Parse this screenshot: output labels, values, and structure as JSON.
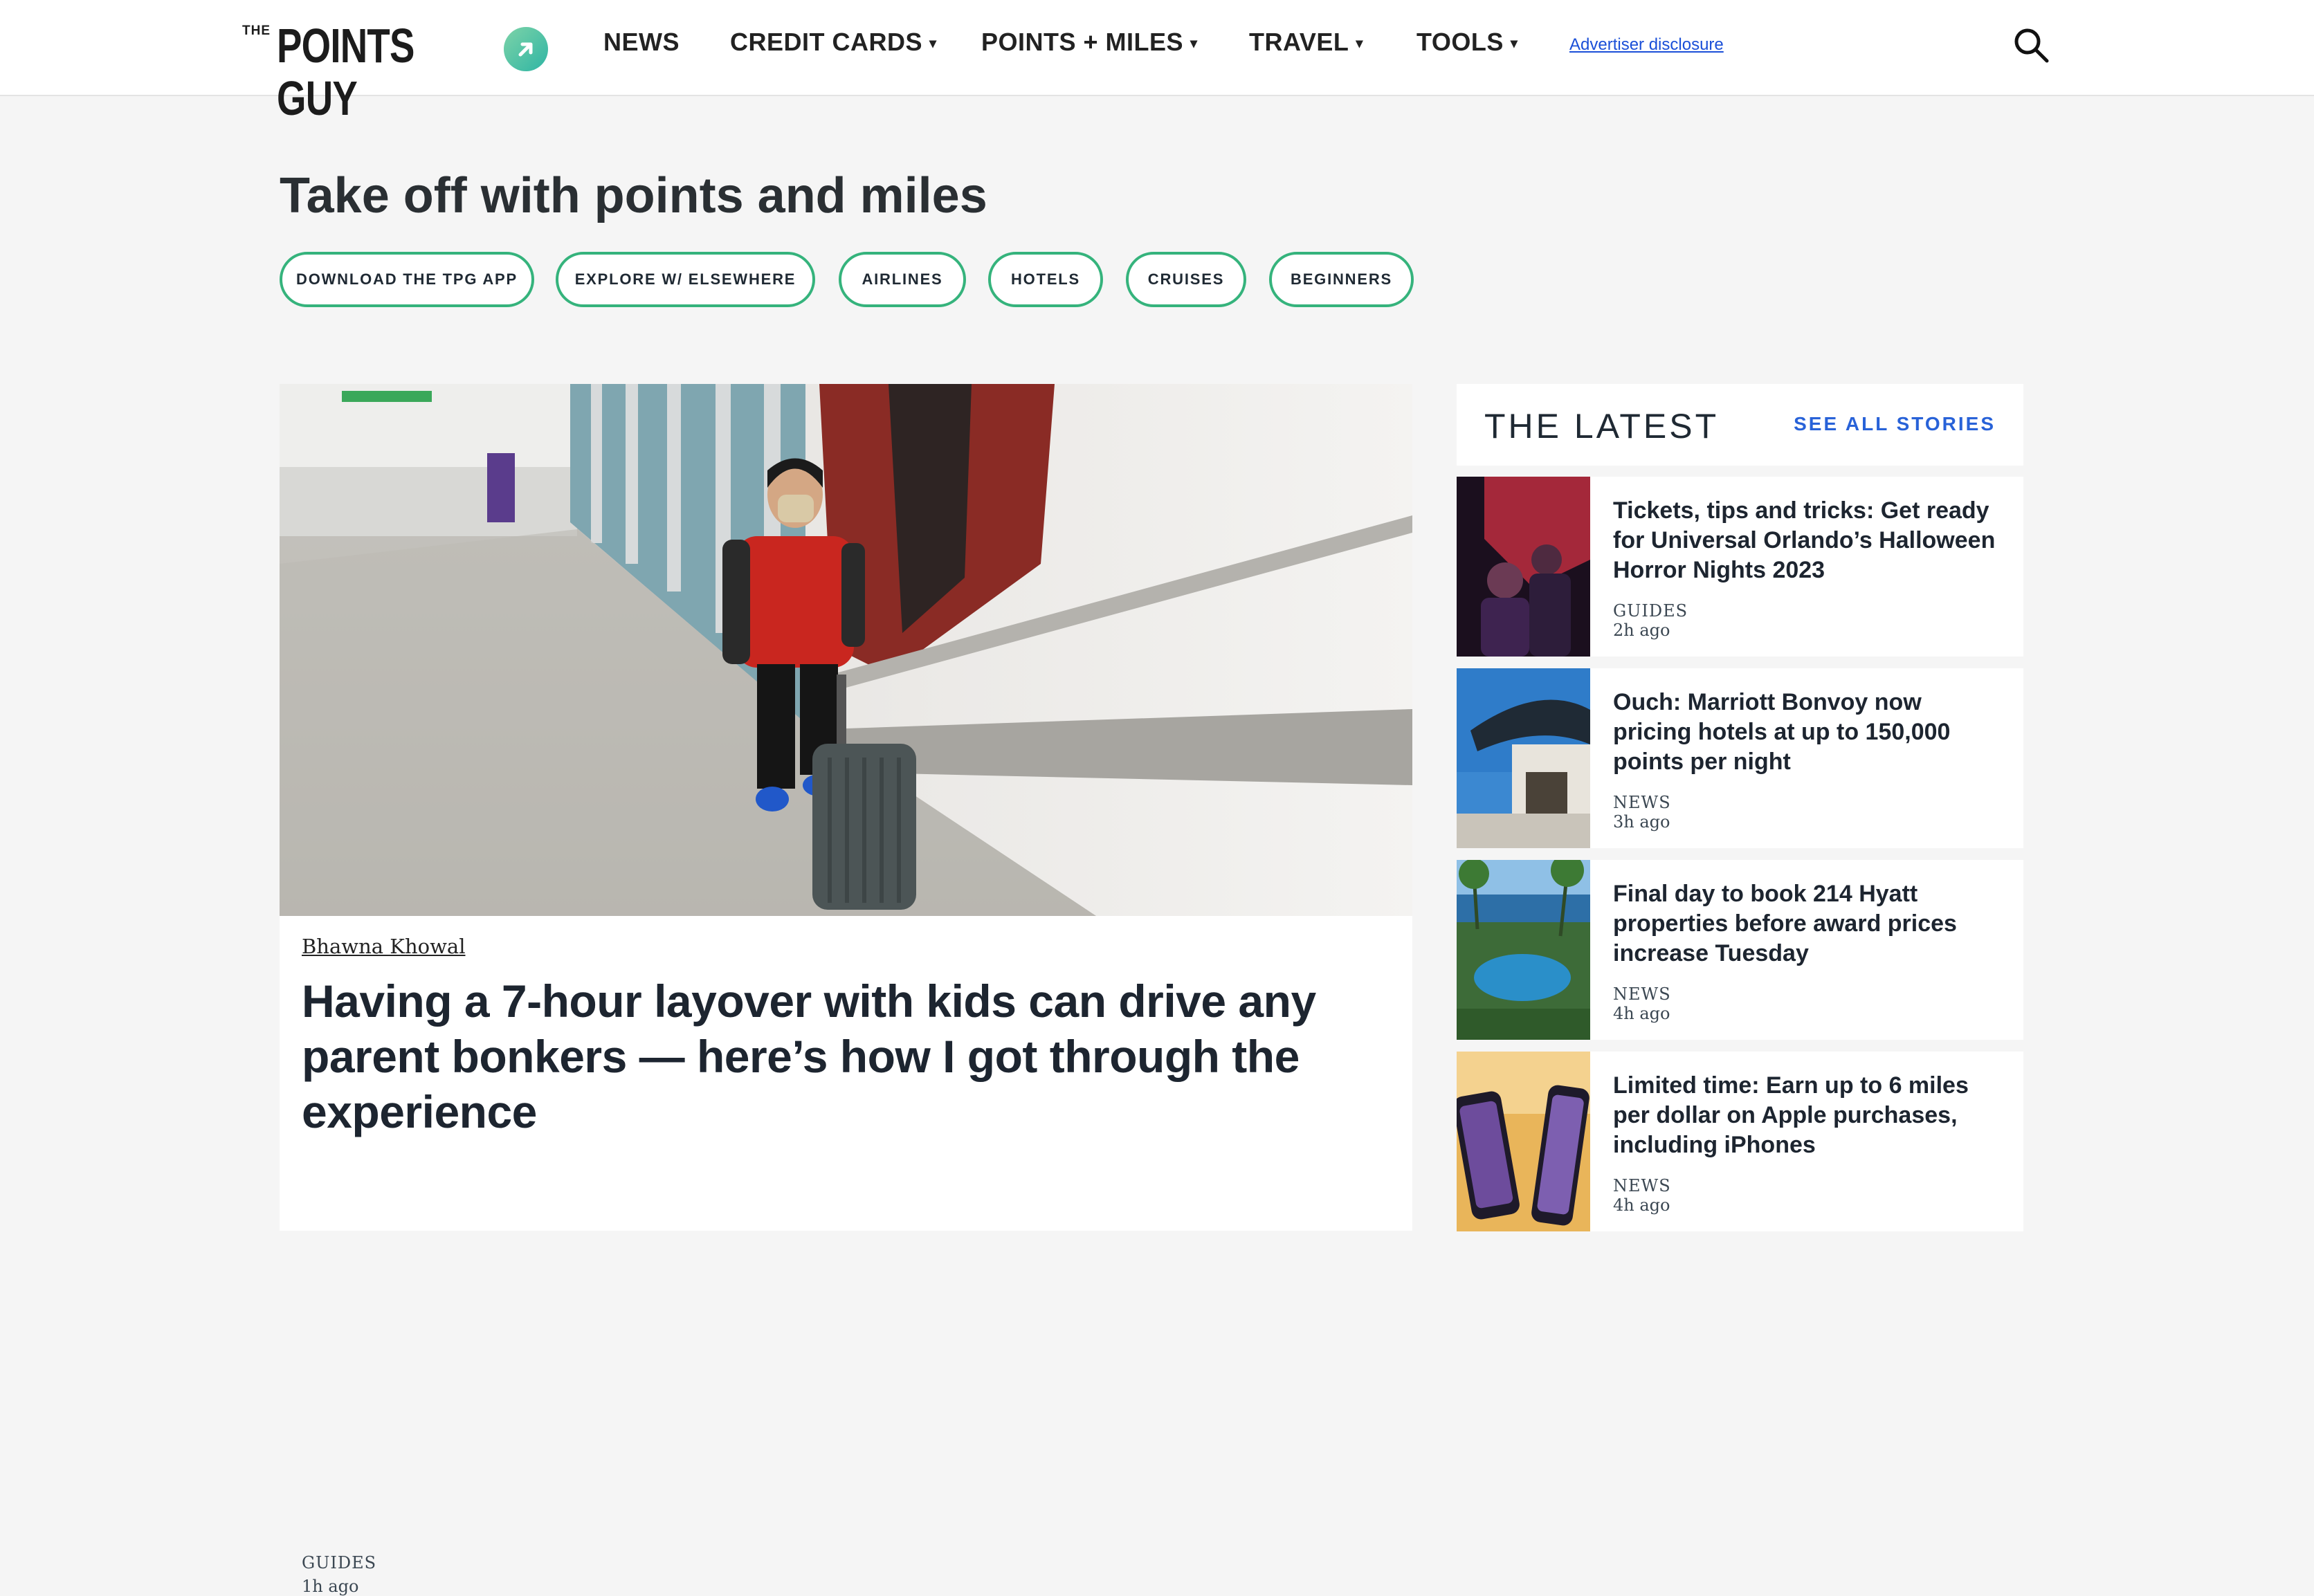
{
  "header": {
    "logo_the": "THE",
    "logo_main": "POINTS GUY",
    "nav": [
      {
        "label": "NEWS",
        "has_caret": false
      },
      {
        "label": "CREDIT CARDS",
        "has_caret": true
      },
      {
        "label": "POINTS + MILES",
        "has_caret": true
      },
      {
        "label": "TRAVEL",
        "has_caret": true
      },
      {
        "label": "TOOLS",
        "has_caret": true
      }
    ],
    "caret": "▾",
    "advertiser_disclosure": "Advertiser disclosure",
    "search_icon": "search-icon"
  },
  "hero": {
    "title": "Take off with points and miles",
    "chips": [
      "DOWNLOAD THE TPG APP",
      "EXPLORE W/ ELSEWHERE",
      "AIRLINES",
      "HOTELS",
      "CRUISES",
      "BEGINNERS"
    ]
  },
  "featured": {
    "author": "Bhawna Khowal",
    "headline": "Having a 7-hour layover with kids can drive any parent bonkers — here’s how I got through the experience",
    "category": "GUIDES",
    "time": "1h ago"
  },
  "latest": {
    "title": "THE LATEST",
    "see_all": "SEE ALL STORIES",
    "stories": [
      {
        "title": "Tickets, tips and tricks: Get ready for Universal Orlando’s Halloween Horror Nights 2023",
        "category": "GUIDES",
        "time": "2h ago"
      },
      {
        "title": "Ouch: Marriott Bonvoy now pricing hotels at up to 150,000 points per night",
        "category": "NEWS",
        "time": "3h ago"
      },
      {
        "title": "Final day to book 214 Hyatt properties before award prices increase Tuesday",
        "category": "NEWS",
        "time": "4h ago"
      },
      {
        "title": "Limited time: Earn up to 6 miles per dollar on Apple purchases, including iPhones",
        "category": "NEWS",
        "time": "4h ago"
      }
    ]
  },
  "colors": {
    "accent_green": "#35b37c",
    "link_blue": "#2862d8",
    "page_bg": "#f5f5f5"
  }
}
